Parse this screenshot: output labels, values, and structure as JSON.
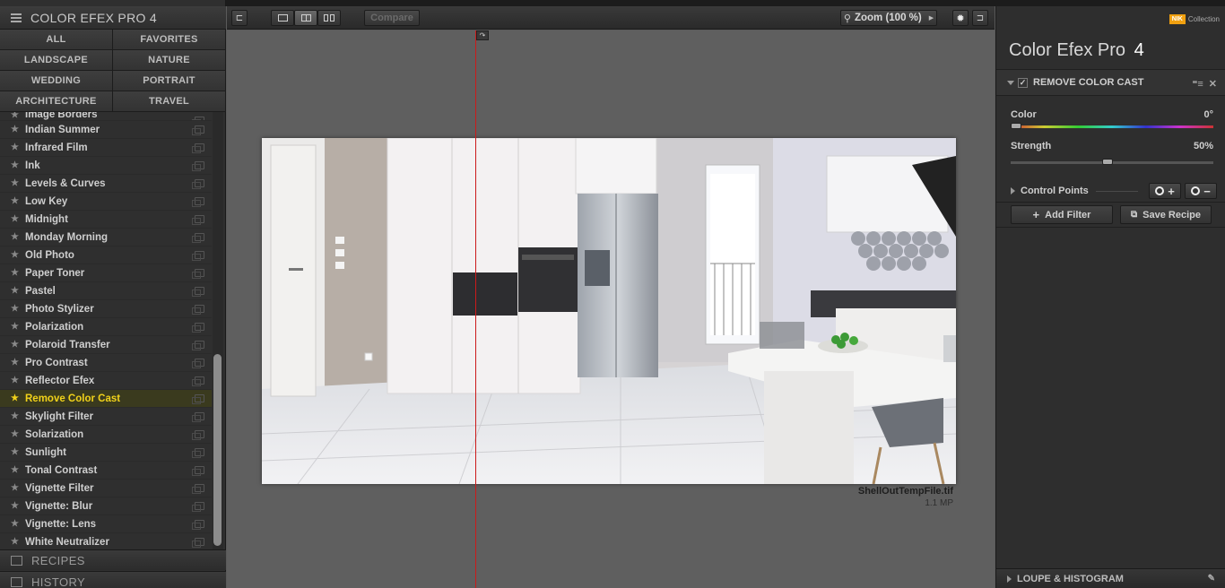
{
  "app": {
    "title": "COLOR EFEX PRO 4"
  },
  "categories": [
    "ALL",
    "FAVORITES",
    "LANDSCAPE",
    "NATURE",
    "WEDDING",
    "PORTRAIT",
    "ARCHITECTURE",
    "TRAVEL"
  ],
  "filters": {
    "partial_top": "Image Borders",
    "items": [
      "Indian Summer",
      "Infrared Film",
      "Ink",
      "Levels & Curves",
      "Low Key",
      "Midnight",
      "Monday Morning",
      "Old Photo",
      "Paper Toner",
      "Pastel",
      "Photo Stylizer",
      "Polarization",
      "Polaroid Transfer",
      "Pro Contrast",
      "Reflector Efex",
      "Remove Color Cast",
      "Skylight Filter",
      "Solarization",
      "Sunlight",
      "Tonal Contrast",
      "Vignette Filter",
      "Vignette: Blur",
      "Vignette: Lens",
      "White Neutralizer"
    ],
    "selected": "Remove Color Cast"
  },
  "bottom_sections": {
    "recipes": "RECIPES",
    "history": "HISTORY"
  },
  "toolbar": {
    "compare": "Compare",
    "zoom": "Zoom (100 %)"
  },
  "canvas": {
    "file_name": "ShellOutTempFile.tif",
    "file_size": "1.1 MP"
  },
  "right_panel": {
    "logo_badge": "NIK",
    "logo_text": "Collection",
    "product_name": "Color Efex Pro",
    "product_version": "4",
    "filter_name": "REMOVE COLOR CAST",
    "color_label": "Color",
    "color_value": "0°",
    "color_level": 0,
    "strength_label": "Strength",
    "strength_value": "50%",
    "strength_level": 0.5,
    "control_points": "Control Points",
    "add_filter": "Add Filter",
    "save_recipe": "Save Recipe",
    "loupe": "LOUPE & HISTOGRAM"
  },
  "colors": {
    "accent_selected": "#f1d21a",
    "split_line": "#cc1a1a",
    "logo_orange": "#f0a010"
  }
}
